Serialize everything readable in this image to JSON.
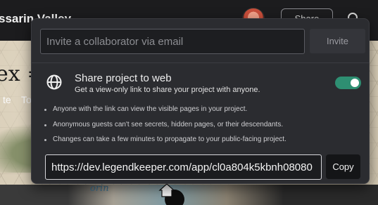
{
  "header": {
    "project_title": "ssarin Valley",
    "share_label": "Share"
  },
  "map": {
    "heading": "ex =",
    "tab_one": "te",
    "tab_two": "To",
    "region_label": "orin"
  },
  "share_popover": {
    "invite_placeholder": "Invite a collaborator via email",
    "invite_label": "Invite",
    "web_share": {
      "title": "Share project to web",
      "subtitle": "Get a view-only link to share your project with anyone.",
      "enabled": true
    },
    "notes": [
      "Anyone with the link can view the visible pages in your project.",
      "Anonymous guests can't see secrets, hidden pages, or their descendants.",
      "Changes can take a few minutes to propagate to your public-facing project."
    ],
    "link_value": "https://dev.legendkeeper.com/app/cl0a804k5kbnh08080",
    "copy_label": "Copy"
  },
  "colors": {
    "toggle_on": "#2e8f72",
    "popover_bg": "#2b2c30"
  },
  "icons": [
    "search-icon",
    "globe-icon",
    "home-icon"
  ]
}
